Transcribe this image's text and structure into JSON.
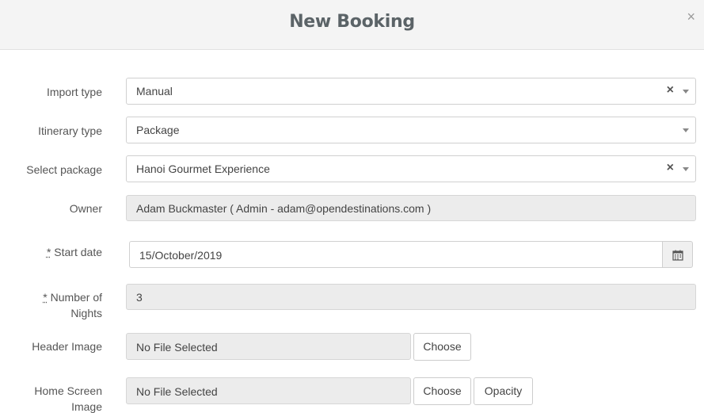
{
  "modal": {
    "title": "New Booking",
    "close": "×"
  },
  "form": {
    "import_type": {
      "label": "Import type",
      "value": "Manual",
      "clear": "×"
    },
    "itinerary_type": {
      "label": "Itinerary type",
      "value": "Package"
    },
    "select_package": {
      "label": "Select package",
      "value": "Hanoi Gourmet Experience",
      "clear": "×"
    },
    "owner": {
      "label": "Owner",
      "value": "Adam Buckmaster ( Admin - adam@opendestinations.com  )"
    },
    "start_date": {
      "required_mark": "*",
      "label": " Start date",
      "value": "15/October/2019",
      "icon": "calendar-icon"
    },
    "number_of_nights": {
      "required_mark": "*",
      "label_line1": " Number of",
      "label_line2": "Nights",
      "value": "3"
    },
    "header_image": {
      "label": "Header Image",
      "file_text": "No File Selected",
      "choose": "Choose"
    },
    "home_screen_image": {
      "label_line1": "Home Screen",
      "label_line2": "Image",
      "file_text": "No File Selected",
      "choose": "Choose",
      "opacity": "Opacity"
    }
  }
}
